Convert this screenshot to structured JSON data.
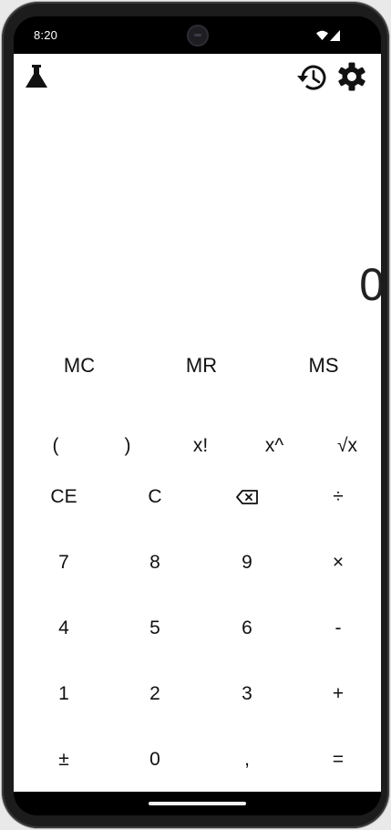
{
  "status_bar": {
    "time": "8:20",
    "icons": [
      "wifi-icon",
      "cellular-signal-icon"
    ]
  },
  "toolbar": {
    "left_icon": "flask-icon",
    "right_icons": [
      "history-icon",
      "settings-icon"
    ]
  },
  "display": {
    "value": "0"
  },
  "memory_row": [
    "MC",
    "MR",
    "MS"
  ],
  "function_row": [
    "(",
    ")",
    "x!",
    "x^",
    "√x"
  ],
  "keypad_rows": [
    [
      "CE",
      "C",
      "",
      "÷"
    ],
    [
      "7",
      "8",
      "9",
      "×"
    ],
    [
      "4",
      "5",
      "6",
      "-"
    ],
    [
      "1",
      "2",
      "3",
      "+"
    ],
    [
      "±",
      "0",
      ",",
      "="
    ]
  ],
  "backspace_icon": "backspace-icon",
  "colors": {
    "background": "#ffffff",
    "text": "#111111",
    "frame": "#1c1c1c"
  }
}
